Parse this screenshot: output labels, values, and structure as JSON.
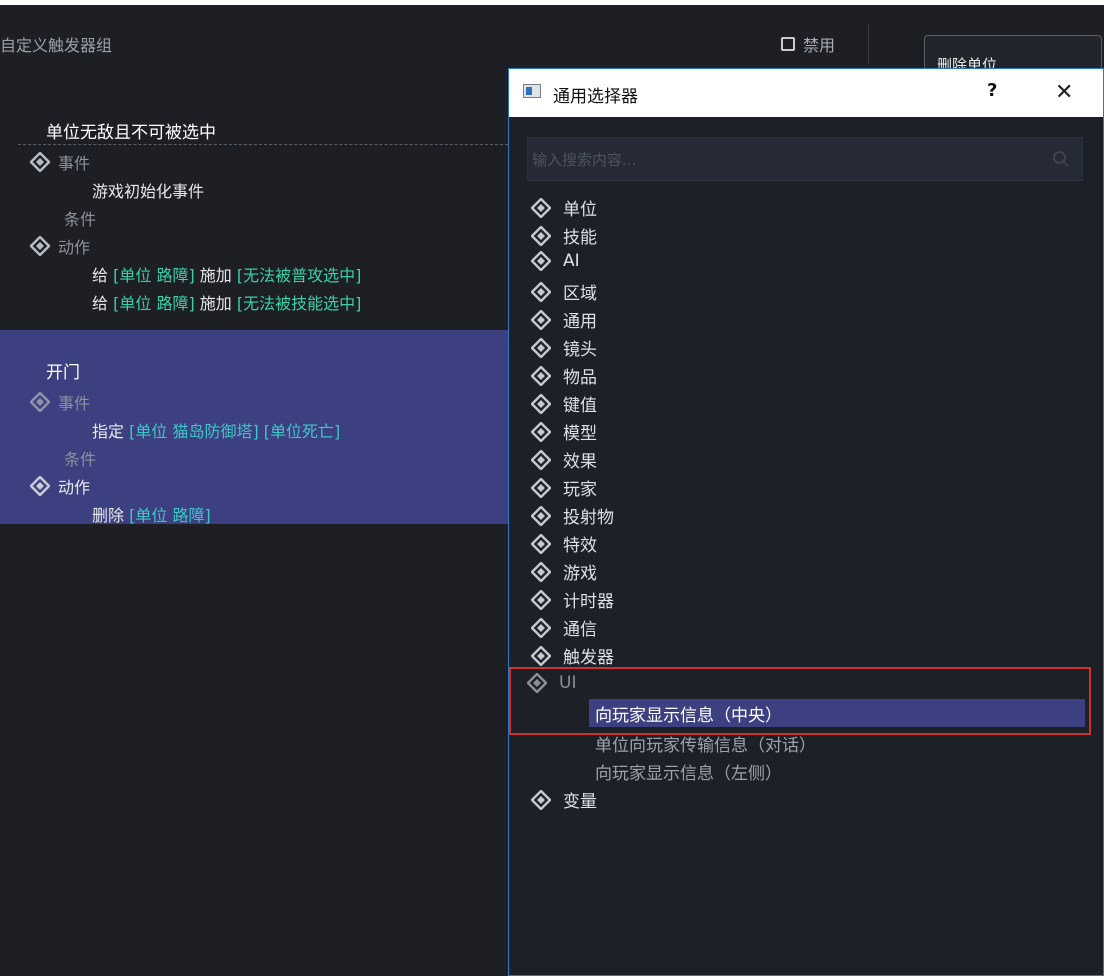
{
  "header": {
    "group_title": "自定义触发器组",
    "disable_label": "禁用",
    "delete_unit_button": "删除单位"
  },
  "triggers": [
    {
      "name": "单位无敌且不可被选中",
      "events_label": "事件",
      "event_stmt": "游戏初始化事件",
      "conditions_label": "条件",
      "actions_label": "动作",
      "actions": [
        {
          "verb": "给",
          "target": "[单位 路障]",
          "op": "施加",
          "effect": "[无法被普攻选中]"
        },
        {
          "verb": "给",
          "target": "[单位 路障]",
          "op": "施加",
          "effect": "[无法被技能选中]"
        }
      ]
    },
    {
      "name": "开门",
      "events_label": "事件",
      "event_verb": "指定",
      "event_target": "[单位 猫岛防御塔]",
      "event_type": "[单位死亡]",
      "conditions_label": "条件",
      "actions_label": "动作",
      "action_verb": "删除",
      "action_target": "[单位 路障]"
    }
  ],
  "dialog": {
    "title": "通用选择器",
    "help": "?",
    "close": "✕",
    "search_placeholder": "输入搜索内容...",
    "categories": [
      "单位",
      "技能",
      "AI",
      "区域",
      "通用",
      "镜头",
      "物品",
      "键值",
      "模型",
      "效果",
      "玩家",
      "投射物",
      "特效",
      "游戏",
      "计时器",
      "通信",
      "触发器"
    ],
    "ui_category": "UI",
    "ui_items": [
      "向玩家显示信息（中央）",
      "单位向玩家传输信息（对话）",
      "向玩家显示信息（左侧）"
    ],
    "last_category": "变量"
  },
  "colors": {
    "background": "#1d1f25",
    "selection": "#3d4080",
    "keyword_green": "#3ad0a8",
    "highlight_frame": "#d03030"
  }
}
